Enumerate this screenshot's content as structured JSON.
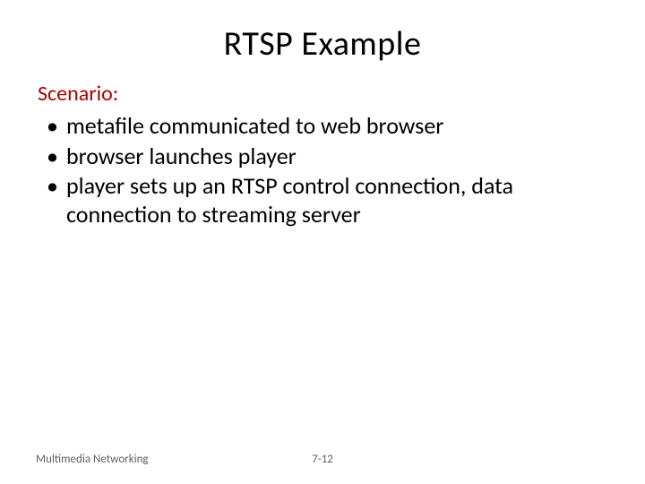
{
  "title": "RTSP Example",
  "subhead": "Scenario:",
  "bullets": [
    "metafile communicated to web browser",
    "browser launches player",
    "player sets up an RTSP control connection, data connection to streaming server"
  ],
  "footer": {
    "left": "Multimedia Networking",
    "center": "7-12"
  }
}
